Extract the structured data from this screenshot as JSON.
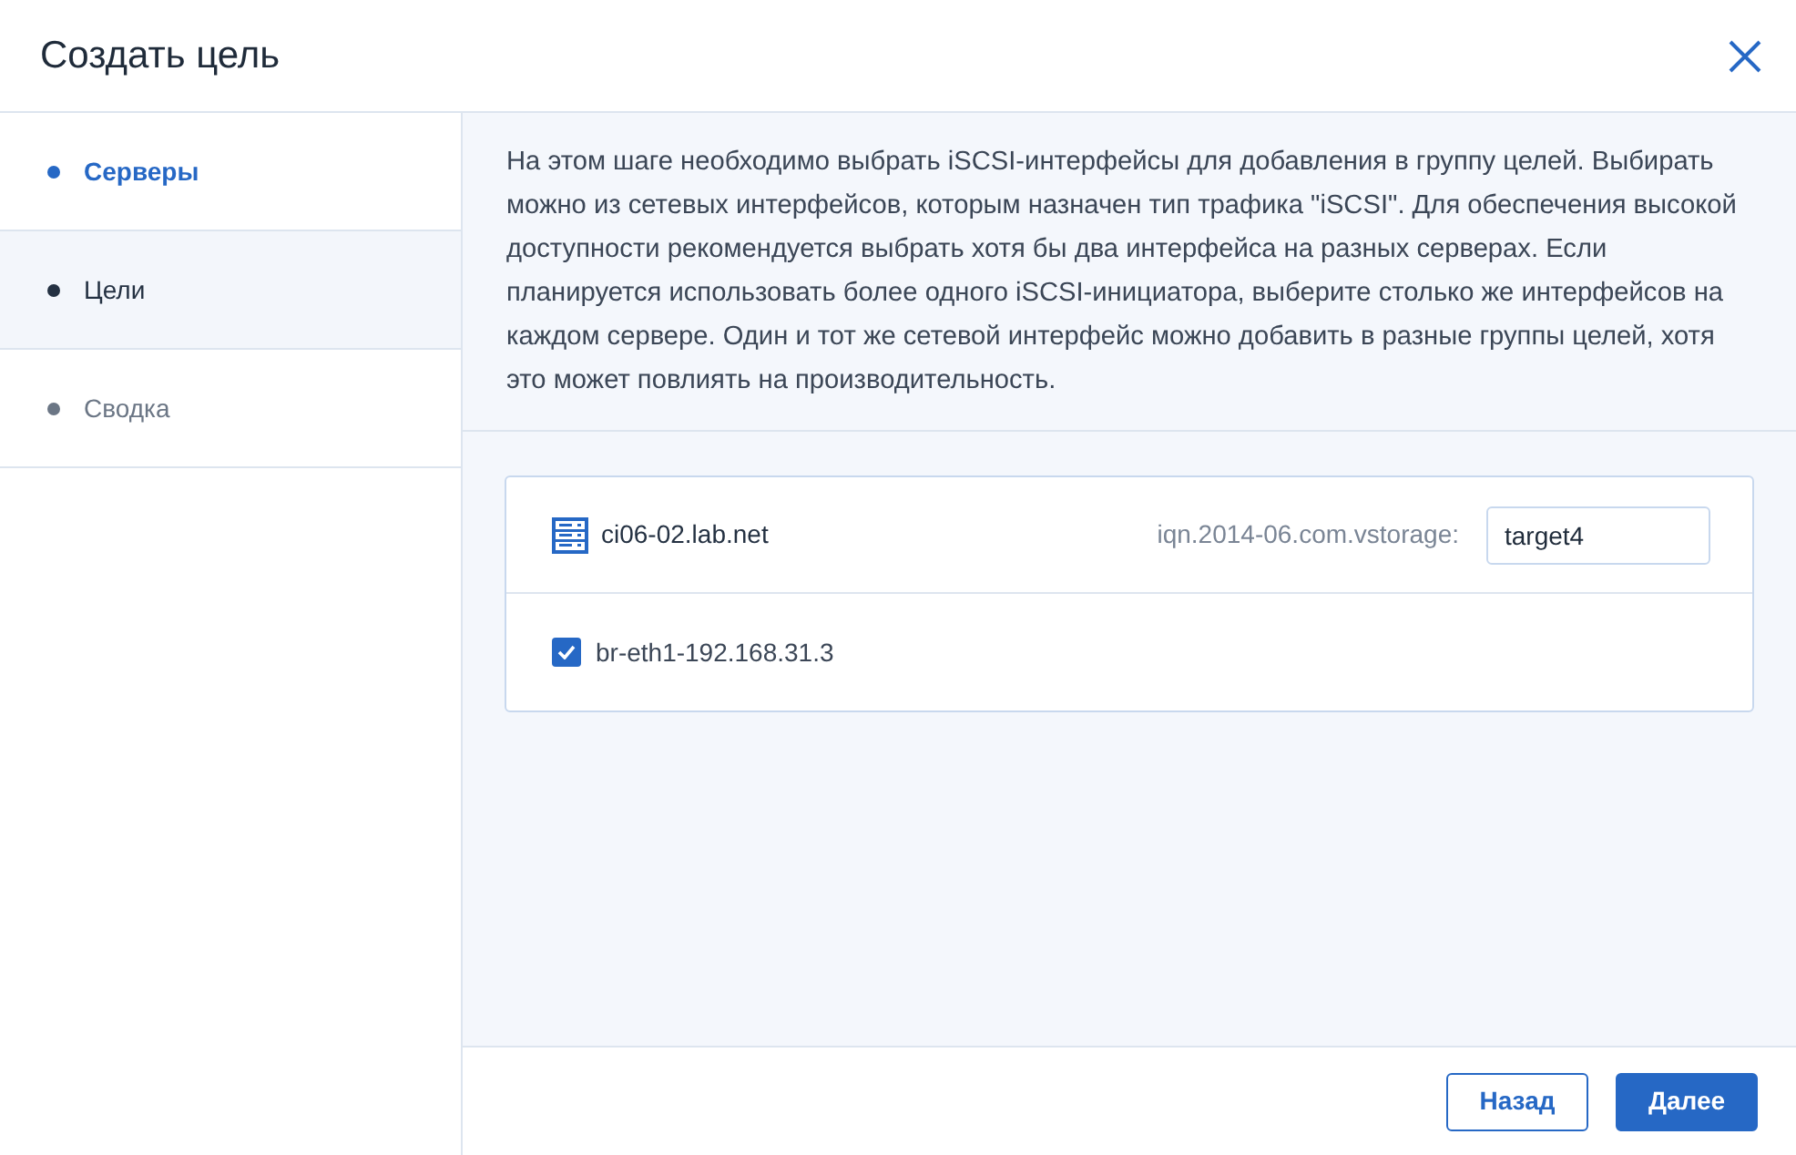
{
  "window": {
    "title": "Создать цель"
  },
  "steps": [
    {
      "label": "Серверы",
      "completed": true,
      "selected": false
    },
    {
      "label": "Цели",
      "completed": false,
      "selected": true
    },
    {
      "label": "Сводка",
      "completed": false,
      "selected": false
    }
  ],
  "description": "На этом шаге необходимо выбрать iSCSI-интерфейсы для добавления в группу целей. Выбирать можно из сетевых интерфейсов, которым назначен тип трафика \"iSCSI\". Для обеспечения высокой доступности рекомендуется выбрать хотя бы два интерфейса на разных серверах. Если планируется использовать более одного iSCSI-инициатора, выберите столько же интерфейсов на каждом сервере. Один и тот же сетевой интерфейс можно добавить в разные группы целей, хотя это может повлиять на производительность.",
  "servers": [
    {
      "hostname": "ci06-02.lab.net",
      "iqn_prefix": "iqn.2014-06.com.vstorage:",
      "target_name": "target4",
      "interfaces": [
        {
          "name": "br-eth1-192.168.31.3",
          "checked": true
        }
      ]
    }
  ],
  "buttons": [
    {
      "label": "Назад",
      "kind": "secondary"
    },
    {
      "label": "Далее",
      "kind": "primary"
    }
  ]
}
